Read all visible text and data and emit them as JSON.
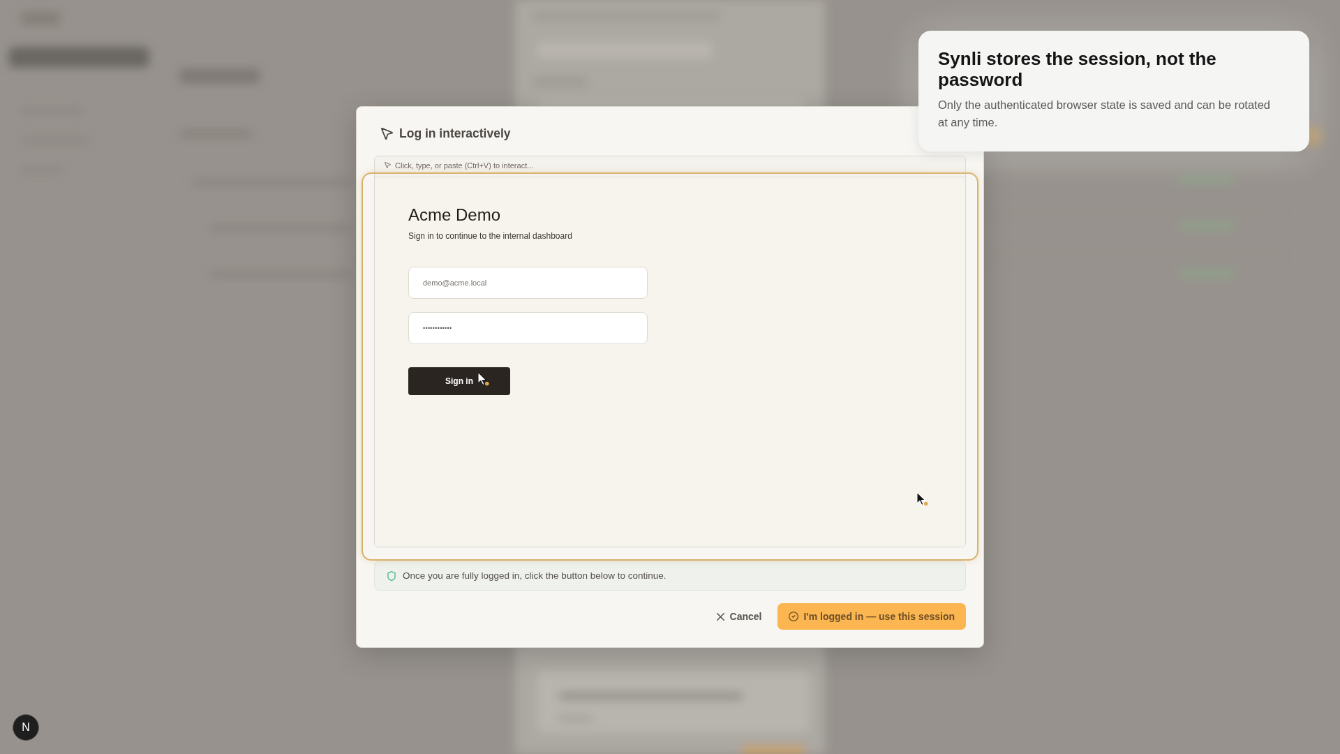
{
  "dialog": {
    "title": "Log in interactively",
    "browser": {
      "hint": "Click, type, or paste (Ctrl+V) to interact...",
      "page": {
        "title": "Acme Demo",
        "subtitle": "Sign in to continue to the internal dashboard",
        "fields": [
          {
            "kind": "email",
            "value": "demo@acme.local"
          },
          {
            "kind": "password",
            "value": "••••••••••••"
          }
        ],
        "button": "Sign in"
      }
    },
    "notice": "Once you are fully logged in, click the button below to continue.",
    "buttons": [
      {
        "kind": "cancel",
        "label": "Cancel"
      },
      {
        "kind": "primary",
        "label": "I'm logged in — use this session"
      }
    ]
  },
  "tour_tip": {
    "title": "Synli stores the session, not the password",
    "body": "Only the authenticated browser state is saved and can be rotated at any time."
  },
  "dev_badge": {
    "label": "N"
  }
}
